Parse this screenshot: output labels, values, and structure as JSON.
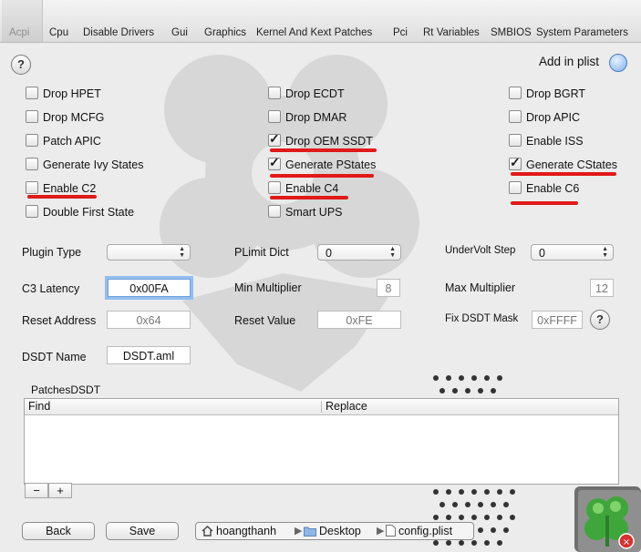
{
  "tabs": [
    {
      "label": "Acpi",
      "active": true
    },
    {
      "label": "Cpu"
    },
    {
      "label": "Disable Drivers"
    },
    {
      "label": "Gui"
    },
    {
      "label": "Graphics"
    },
    {
      "label": "Kernel And Kext Patches"
    },
    {
      "label": "Pci"
    },
    {
      "label": "Rt Variables"
    },
    {
      "label": "SMBIOS"
    },
    {
      "label": "System Parameters"
    }
  ],
  "help_label": "?",
  "add_in_plist_label": "Add in plist",
  "checkboxes": {
    "drop_hpet": {
      "label": "Drop HPET",
      "checked": false
    },
    "drop_mcfg": {
      "label": "Drop MCFG",
      "checked": false
    },
    "patch_apic": {
      "label": "Patch APIC",
      "checked": false
    },
    "generate_ivy_states": {
      "label": "Generate Ivy States",
      "checked": false
    },
    "enable_c2": {
      "label": "Enable C2",
      "checked": false
    },
    "double_first_state": {
      "label": "Double First State",
      "checked": false
    },
    "drop_ecdt": {
      "label": "Drop ECDT",
      "checked": false
    },
    "drop_dmar": {
      "label": "Drop DMAR",
      "checked": false
    },
    "drop_oem_ssdt": {
      "label": "Drop OEM SSDT",
      "checked": true
    },
    "generate_pstates": {
      "label": "Generate PStates",
      "checked": true
    },
    "enable_c4": {
      "label": "Enable C4",
      "checked": false
    },
    "smart_ups": {
      "label": "Smart UPS",
      "checked": false
    },
    "drop_bgrt": {
      "label": "Drop BGRT",
      "checked": false
    },
    "drop_apic": {
      "label": "Drop APIC",
      "checked": false
    },
    "enable_iss": {
      "label": "Enable ISS",
      "checked": false
    },
    "generate_cstates": {
      "label": "Generate CStates",
      "checked": true
    },
    "enable_c6": {
      "label": "Enable C6",
      "checked": false
    }
  },
  "fields": {
    "plugin_type": {
      "label": "Plugin Type",
      "value": ""
    },
    "plimit_dict": {
      "label": "PLimit Dict",
      "value": "0"
    },
    "undervolt_step": {
      "label": "UnderVolt Step",
      "value": "0"
    },
    "c3_latency": {
      "label": "C3 Latency",
      "value": "0x00FA"
    },
    "min_multiplier": {
      "label": "Min Multiplier",
      "value": "8"
    },
    "max_multiplier": {
      "label": "Max Multiplier",
      "value": "12"
    },
    "reset_address": {
      "label": "Reset Address",
      "value": "0x64"
    },
    "reset_value": {
      "label": "Reset Value",
      "value": "0xFE"
    },
    "fix_dsdt_mask": {
      "label": "Fix DSDT Mask",
      "value": "0xFFFF"
    },
    "dsdt_name": {
      "label": "DSDT Name",
      "value": "DSDT.aml"
    }
  },
  "patches_dsdt": {
    "title": "PatchesDSDT",
    "columns": [
      "Find",
      "Replace"
    ],
    "rows": [],
    "remove_label": "−",
    "add_label": "+"
  },
  "buttons": {
    "back": "Back",
    "save": "Save"
  },
  "path": [
    "hoangthanh",
    "Desktop",
    "config.plist"
  ],
  "colors": {
    "annotation_red": "#e11919",
    "focus_ring": "#93bdf0",
    "add_indicator": "#7fb0ee"
  }
}
